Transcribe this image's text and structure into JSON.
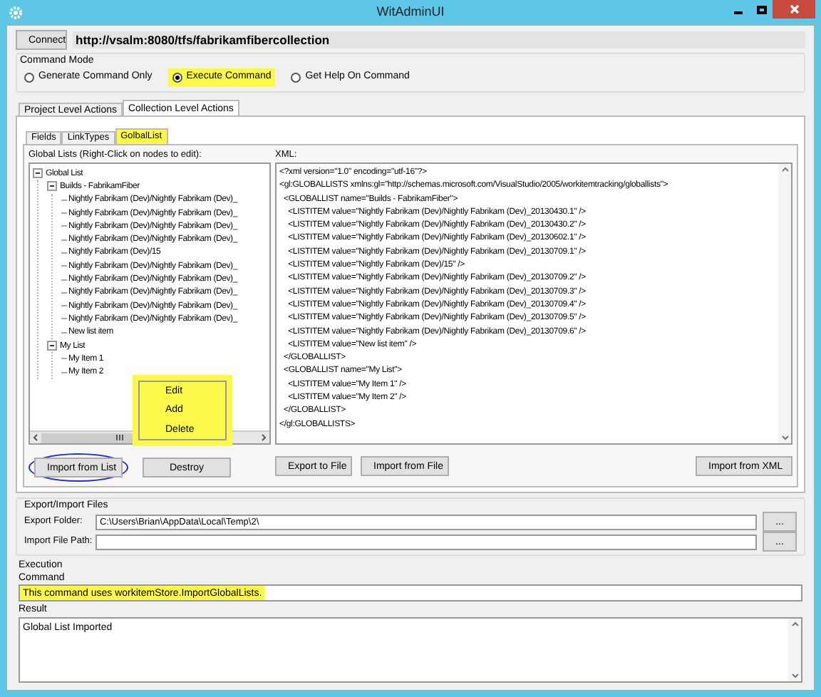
{
  "window": {
    "title": "WitAdminUI"
  },
  "connect_button": "Connect",
  "server_url": "http://vsalm:8080/tfs/fabrikamfibercollection",
  "command_mode": {
    "label": "Command Mode",
    "options": [
      {
        "label": "Generate Command Only",
        "selected": false,
        "highlighted": false
      },
      {
        "label": "Execute Command",
        "selected": true,
        "highlighted": true
      },
      {
        "label": "Get Help On Command",
        "selected": false,
        "highlighted": false
      }
    ]
  },
  "outer_tabs": [
    {
      "label": "Project Level Actions",
      "selected": false
    },
    {
      "label": "Collection Level Actions",
      "selected": true
    }
  ],
  "inner_tabs": [
    {
      "label": "Fields",
      "selected": false,
      "highlighted": false
    },
    {
      "label": "LinkTypes",
      "selected": false,
      "highlighted": false
    },
    {
      "label": "GolbalList",
      "selected": true,
      "highlighted": true
    }
  ],
  "global_lists": {
    "label": "Global Lists (Right-Click on nodes to edit):",
    "tree": [
      {
        "label": "Global List",
        "expanded": true,
        "children": [
          {
            "label": "Builds - FabrikamFiber",
            "expanded": true,
            "children": [
              {
                "label": "Nightly Fabrikam (Dev)/Nightly Fabrikam (Dev)_"
              },
              {
                "label": "Nightly Fabrikam (Dev)/Nightly Fabrikam (Dev)_"
              },
              {
                "label": "Nightly Fabrikam (Dev)/Nightly Fabrikam (Dev)_"
              },
              {
                "label": "Nightly Fabrikam (Dev)/Nightly Fabrikam (Dev)_"
              },
              {
                "label": "Nightly Fabrikam (Dev)/15"
              },
              {
                "label": "Nightly Fabrikam (Dev)/Nightly Fabrikam (Dev)_"
              },
              {
                "label": "Nightly Fabrikam (Dev)/Nightly Fabrikam (Dev)_"
              },
              {
                "label": "Nightly Fabrikam (Dev)/Nightly Fabrikam (Dev)_"
              },
              {
                "label": "Nightly Fabrikam (Dev)/Nightly Fabrikam (Dev)_"
              },
              {
                "label": "Nightly Fabrikam (Dev)/Nightly Fabrikam (Dev)_"
              },
              {
                "label": "New list item"
              }
            ]
          },
          {
            "label": "My List",
            "expanded": true,
            "children": [
              {
                "label": "My Item 1"
              },
              {
                "label": "My Item 2"
              }
            ]
          }
        ]
      }
    ]
  },
  "context_menu": {
    "highlighted": true,
    "items": [
      "Edit",
      "Add",
      "Delete"
    ]
  },
  "xml": {
    "label": "XML:",
    "lines": [
      "<?xml version=\"1.0\" encoding=\"utf-16\"?>",
      "<gl:GLOBALLISTS xmlns:gl=\"http://schemas.microsoft.com/VisualStudio/2005/workitemtracking/globallists\">",
      "  <GLOBALLIST name=\"Builds - FabrikamFiber\">",
      "    <LISTITEM value=\"Nightly Fabrikam (Dev)/Nightly Fabrikam (Dev)_20130430.1\" />",
      "    <LISTITEM value=\"Nightly Fabrikam (Dev)/Nightly Fabrikam (Dev)_20130430.2\" />",
      "    <LISTITEM value=\"Nightly Fabrikam (Dev)/Nightly Fabrikam (Dev)_20130602.1\" />",
      "    <LISTITEM value=\"Nightly Fabrikam (Dev)/Nightly Fabrikam (Dev)_20130709.1\" />",
      "    <LISTITEM value=\"Nightly Fabrikam (Dev)/15\" />",
      "    <LISTITEM value=\"Nightly Fabrikam (Dev)/Nightly Fabrikam (Dev)_20130709.2\" />",
      "    <LISTITEM value=\"Nightly Fabrikam (Dev)/Nightly Fabrikam (Dev)_20130709.3\" />",
      "    <LISTITEM value=\"Nightly Fabrikam (Dev)/Nightly Fabrikam (Dev)_20130709.4\" />",
      "    <LISTITEM value=\"Nightly Fabrikam (Dev)/Nightly Fabrikam (Dev)_20130709.5\" />",
      "    <LISTITEM value=\"Nightly Fabrikam (Dev)/Nightly Fabrikam (Dev)_20130709.6\" />",
      "    <LISTITEM value=\"New list item\" />",
      "  </GLOBALLIST>",
      "  <GLOBALLIST name=\"My List\">",
      "    <LISTITEM value=\"My Item 1\" />",
      "    <LISTITEM value=\"My Item 2\" />",
      "  </GLOBALLIST>",
      "</gl:GLOBALLISTS>"
    ]
  },
  "list_buttons": [
    {
      "label": "Import from List",
      "circled": true
    },
    {
      "label": "Destroy",
      "circled": false
    }
  ],
  "xml_buttons": [
    "Export to File",
    "Import from File",
    "Import from XML"
  ],
  "export_import": {
    "title": "Export/Import Files",
    "fields": [
      {
        "label": "Export Folder:",
        "value": "C:\\Users\\Brian\\AppData\\Local\\Temp\\2\\",
        "browse": "..."
      },
      {
        "label": "Import File Path:",
        "browse": "..."
      }
    ]
  },
  "execution": {
    "title": "Execution",
    "command_label": "Command",
    "command": "This command uses workitemStore.ImportGlobalLists.",
    "command_highlighted": true,
    "result_label": "Result",
    "result": "Global List Imported"
  }
}
